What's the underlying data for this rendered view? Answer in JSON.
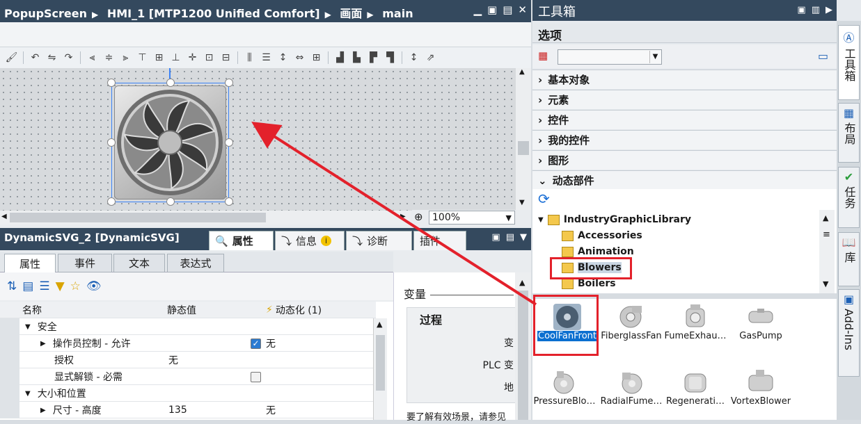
{
  "editor": {
    "breadcrumb": [
      "PopupScreen",
      "HMI_1 [MTP1200 Unified Comfort]",
      "画面",
      "main"
    ],
    "zoom": "100%"
  },
  "properties": {
    "title": "DynamicSVG_2 [DynamicSVG]",
    "tabs": [
      "属性",
      "信息",
      "诊断",
      "插件"
    ],
    "subtabs": [
      "属性",
      "事件",
      "文本",
      "表达式"
    ],
    "columns": [
      "名称",
      "静态值",
      "动态化 (1)"
    ],
    "rows": [
      {
        "name": "安全",
        "value": "",
        "dyn": "",
        "group": true,
        "expanded": true
      },
      {
        "name": "操作员控制 - 允许",
        "value": "",
        "dyn": "无",
        "check": true,
        "checked": true,
        "indent": 2,
        "arrow": true
      },
      {
        "name": "授权",
        "value": "无",
        "dyn": "",
        "indent": 2
      },
      {
        "name": "显式解锁 - 必需",
        "value": "",
        "dyn": "",
        "check": true,
        "checked": false,
        "indent": 2
      },
      {
        "name": "大小和位置",
        "value": "",
        "dyn": "",
        "group": true,
        "expanded": true
      },
      {
        "name": "尺寸 - 高度",
        "value": "135",
        "dyn": "无",
        "indent": 2,
        "arrow": true
      }
    ],
    "var_title": "变量",
    "process_title": "过程",
    "var_labels": [
      "变",
      "PLC 变",
      "地"
    ],
    "hint": "要了解有效场景，请参见"
  },
  "toolbox": {
    "title": "工具箱",
    "options_label": "选项",
    "categories": [
      "基本对象",
      "元素",
      "控件",
      "我的控件",
      "图形",
      "动态部件"
    ],
    "library": "IndustryGraphicLibrary",
    "folders": [
      "Accessories",
      "Animation",
      "Blowers",
      "Boilers"
    ],
    "gallery": [
      "CoolFanFront",
      "FiberglassFan",
      "FumeExhau…",
      "GasPump",
      "PressureBlo…",
      "RadialFume…",
      "Regenerati…",
      "VortexBlower"
    ],
    "side_tabs": [
      "工具箱",
      "布局",
      "任务",
      "库",
      "Add-Ins"
    ]
  },
  "colors": {
    "titlebar": "#34495e",
    "highlight": "#0b6fd0",
    "annotation": "#e3212b"
  }
}
